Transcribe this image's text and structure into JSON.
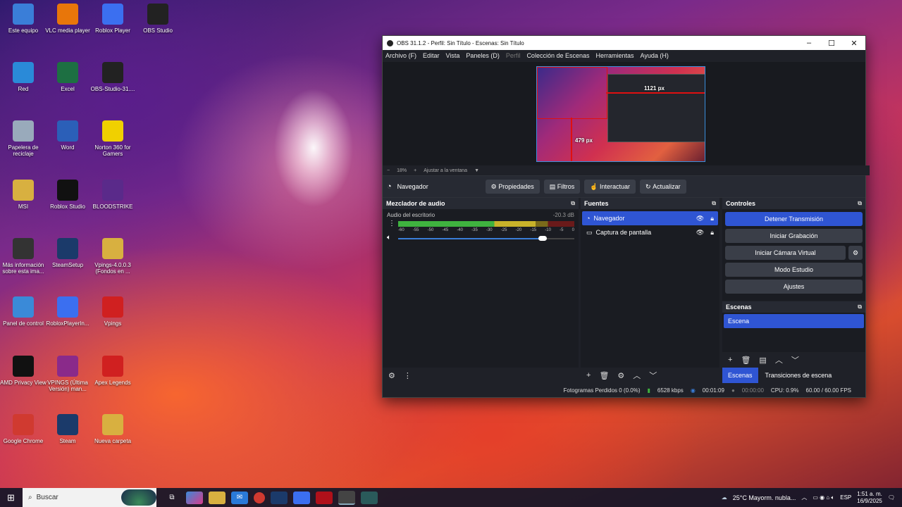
{
  "desktop": {
    "icons": [
      {
        "label": "Este equipo",
        "icon": "computer-icon",
        "color": "#3a7ed8"
      },
      {
        "label": "VLC media player",
        "icon": "vlc-icon",
        "color": "#e8760a"
      },
      {
        "label": "Roblox Player",
        "icon": "roblox-icon",
        "color": "#3b6ff0"
      },
      {
        "label": "OBS Studio",
        "icon": "obs-icon",
        "color": "#222"
      },
      {
        "label": "Red",
        "icon": "network-icon",
        "color": "#2a8ad8"
      },
      {
        "label": "Excel",
        "icon": "excel-icon",
        "color": "#1d6f42"
      },
      {
        "label": "OBS-Studio-31....",
        "icon": "obs-installer-icon",
        "color": "#222"
      },
      {
        "label": "Papelera de reciclaje",
        "icon": "recycle-bin-icon",
        "color": "#9ab"
      },
      {
        "label": "Word",
        "icon": "word-icon",
        "color": "#2b5fb8"
      },
      {
        "label": "Norton 360 for Gamers",
        "icon": "norton-icon",
        "color": "#f0d000"
      },
      {
        "label": "MSI",
        "icon": "folder-icon",
        "color": "#d8b040"
      },
      {
        "label": "Roblox Studio",
        "icon": "roblox-studio-icon",
        "color": "#111"
      },
      {
        "label": "BLOODSTRIKE",
        "icon": "bloodstrike-icon",
        "color": "#5a2a8a"
      },
      {
        "label": "Más información sobre esta ima...",
        "icon": "info-icon",
        "color": "#333"
      },
      {
        "label": "SteamSetup",
        "icon": "steam-icon",
        "color": "#1b3a6a"
      },
      {
        "label": "Vpings-4.0.0.3 (Fondos en ...",
        "icon": "zip-icon",
        "color": "#d8b040"
      },
      {
        "label": "Panel de control",
        "icon": "control-panel-icon",
        "color": "#3a8ad8"
      },
      {
        "label": "RobloxPlayerIn...",
        "icon": "roblox-installer-icon",
        "color": "#3b6ff0"
      },
      {
        "label": "Vpings",
        "icon": "vpings-icon",
        "color": "#d02020"
      },
      {
        "label": "AMD Privacy View",
        "icon": "amd-privacy-icon",
        "color": "#111"
      },
      {
        "label": "VPINGS (Última Versión) man...",
        "icon": "winrar-icon",
        "color": "#8a2a8a"
      },
      {
        "label": "Apex Legends",
        "icon": "apex-icon",
        "color": "#d02020"
      },
      {
        "label": "Google Chrome",
        "icon": "chrome-icon",
        "color": "#d03a30"
      },
      {
        "label": "Steam",
        "icon": "steam-icon",
        "color": "#1b3a6a"
      },
      {
        "label": "Nueva carpeta",
        "icon": "folder-icon",
        "color": "#d8b040"
      }
    ]
  },
  "obs": {
    "title": "OBS 31.1.2 - Perfil: Sin Título - Escenas: Sin Título",
    "menu": [
      "Archivo (F)",
      "Editar",
      "Vista",
      "Paneles (D)",
      "Perfil",
      "Colección de Escenas",
      "Herramientas",
      "Ayuda (H)"
    ],
    "preview": {
      "width_label": "1121 px",
      "height_label": "479 px"
    },
    "zoom": {
      "minus": "−",
      "value": "18%",
      "plus": "+",
      "fit": "Ajustar a la ventana"
    },
    "context": {
      "source": "Navegador",
      "buttons": [
        "Propiedades",
        "Filtros",
        "Interactuar",
        "Actualizar"
      ]
    },
    "mixer": {
      "title": "Mezclador de audio",
      "track": "Audio del escritorio",
      "db": "-20.3 dB",
      "level": 0.78,
      "scale": [
        "-60",
        "-55",
        "-50",
        "-45",
        "-40",
        "-35",
        "-30",
        "-25",
        "-20",
        "-15",
        "-10",
        "-5",
        "0"
      ],
      "volume": 0.82
    },
    "sources": {
      "title": "Fuentes",
      "items": [
        {
          "name": "Navegador",
          "selected": true
        },
        {
          "name": "Captura de pantalla",
          "selected": false
        }
      ]
    },
    "controls": {
      "title": "Controles",
      "buttons": [
        "Detener Transmisión",
        "Iniciar Grabación",
        "Iniciar Cámara Virtual",
        "Modo Estudio",
        "Ajustes"
      ]
    },
    "scenes": {
      "title": "Escenas",
      "items": [
        "Escena"
      ],
      "tabs": [
        "Escenas",
        "Transiciones de escena"
      ]
    },
    "status": {
      "dropped": "Fotogramas Perdidos 0 (0.0%)",
      "bitrate": "6528 kbps",
      "stream_time": "00:01:09",
      "rec_time": "00:00:00",
      "cpu": "CPU: 0.9%",
      "fps": "60.00 / 60.00 FPS"
    }
  },
  "taskbar": {
    "search_placeholder": "Buscar",
    "weather": "25°C  Mayorm. nubla...",
    "lang": "ESP",
    "time": "1:51 a. m.",
    "date": "16/9/2025"
  }
}
